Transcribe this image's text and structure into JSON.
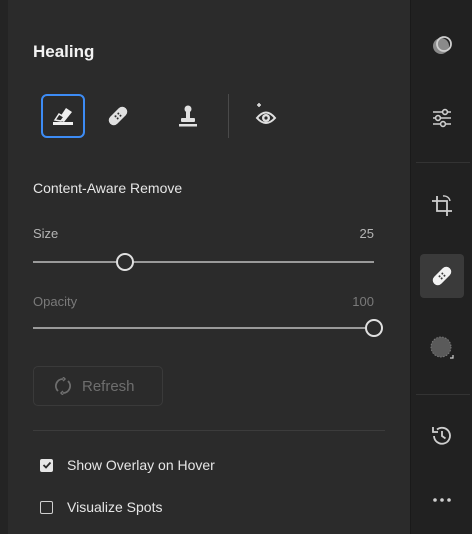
{
  "panel": {
    "title": "Healing",
    "tools": [
      {
        "name": "eraser-remove",
        "active": true
      },
      {
        "name": "heal-bandage",
        "active": false
      },
      {
        "name": "clone-stamp",
        "active": false
      },
      {
        "name": "red-eye",
        "active": false
      }
    ],
    "section_label": "Content-Aware Remove",
    "size": {
      "label": "Size",
      "value": "25",
      "fraction": 0.27
    },
    "opacity": {
      "label": "Opacity",
      "value": "100",
      "fraction": 1.0
    },
    "refresh_label": "Refresh",
    "options": [
      {
        "label": "Show Overlay on Hover",
        "checked": true
      },
      {
        "label": "Visualize Spots",
        "checked": false
      }
    ]
  },
  "rail": {
    "icons": [
      "mask-icon",
      "adjustments-sliders-icon",
      "crop-rotate-icon",
      "healing-bandage-icon",
      "masking-dots-icon",
      "history-icon",
      "more-icon"
    ],
    "active": "healing-bandage-icon"
  }
}
